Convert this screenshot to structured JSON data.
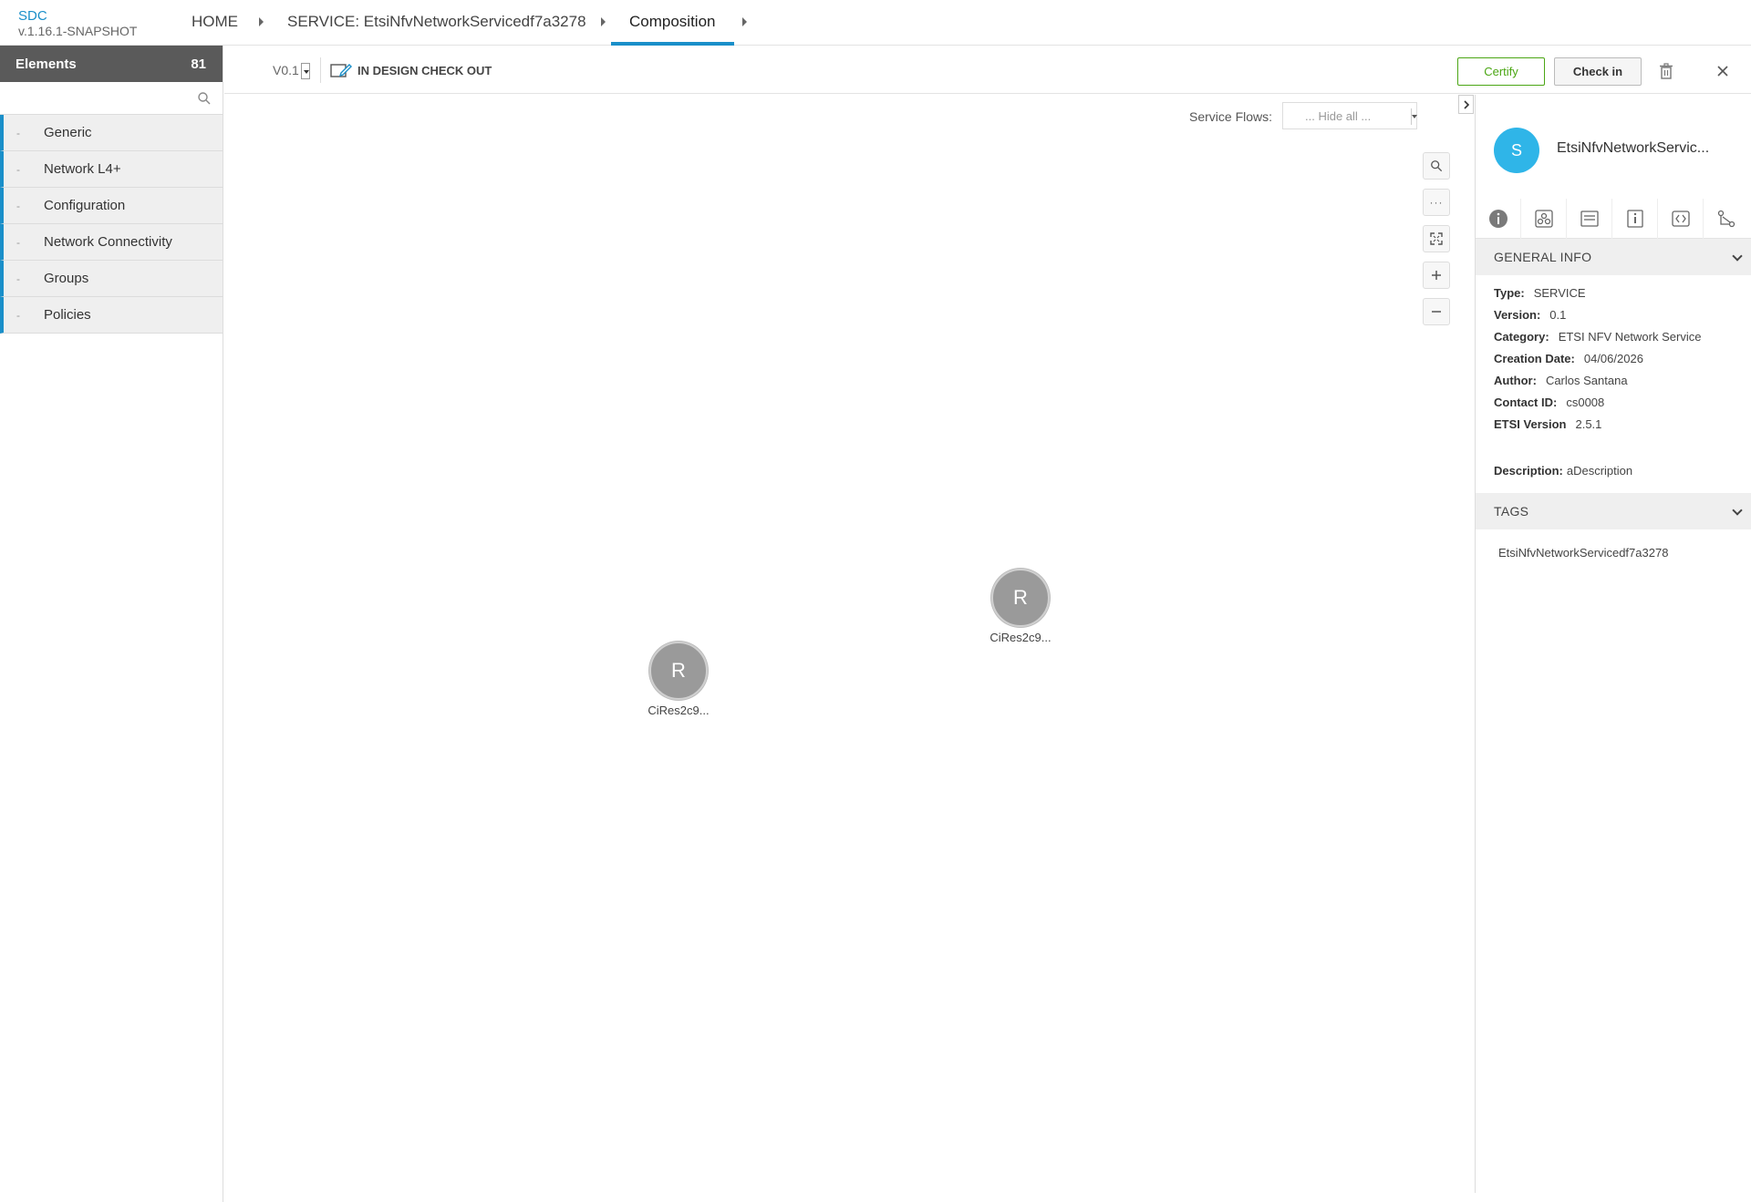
{
  "header": {
    "brand_name": "SDC",
    "brand_version": "v.1.16.1-SNAPSHOT",
    "breadcrumbs": [
      "HOME",
      "SERVICE: EtsiNfvNetworkServicedf7a3278",
      "Composition"
    ]
  },
  "left_panel": {
    "title": "Elements",
    "count": "81",
    "search_placeholder": "",
    "groups": [
      {
        "dash": "-",
        "label": "Generic"
      },
      {
        "dash": "-",
        "label": "Network L4+"
      },
      {
        "dash": "-",
        "label": "Configuration"
      },
      {
        "dash": "-",
        "label": "Network Connectivity"
      },
      {
        "dash": "-",
        "label": "Groups"
      },
      {
        "dash": "-",
        "label": "Policies"
      }
    ]
  },
  "toolbar": {
    "version": "V0.1",
    "status": "IN DESIGN CHECK OUT",
    "certify_label": "Certify",
    "checkin_label": "Check in"
  },
  "canvas": {
    "service_flows_label": "Service Flows:",
    "service_flows_value": "... Hide all ...",
    "zoom_controls": [
      "search-icon",
      "more-icon",
      "fit-icon",
      "zoom-in-icon",
      "zoom-out-icon"
    ],
    "nodes": [
      {
        "letter": "R",
        "label": "CiRes2c9..."
      },
      {
        "letter": "R",
        "label": "CiRes2c9..."
      }
    ]
  },
  "right_panel": {
    "avatar_letter": "S",
    "service_name": "EtsiNfvNetworkServic...",
    "tab_icons": [
      "info-icon",
      "deployment-icon",
      "properties-icon",
      "attributes-icon",
      "api-icon",
      "composition-icon"
    ],
    "general_info_title": "GENERAL INFO",
    "info": {
      "type_k": "Type:",
      "type_v": "SERVICE",
      "version_k": "Version:",
      "version_v": "0.1",
      "category_k": "Category:",
      "category_v": "ETSI NFV Network Service",
      "creation_k": "Creation Date:",
      "creation_v": "04/06/2026",
      "author_k": "Author:",
      "author_v": "Carlos Santana",
      "contact_k": "Contact ID:",
      "contact_v": "cs0008",
      "etsi_k": "ETSI Version",
      "etsi_v": "2.5.1",
      "desc_k": "Description:",
      "desc_v": "aDescription"
    },
    "tags_title": "TAGS",
    "tags": [
      "EtsiNfvNetworkServicedf7a3278"
    ]
  },
  "colors": {
    "accent": "#1a8fc9",
    "certify_green": "#4ba614",
    "avatar_blue": "#2fb5e8",
    "node_gray": "#9a9a9a",
    "panel_header_dark": "#5a5a5a"
  }
}
